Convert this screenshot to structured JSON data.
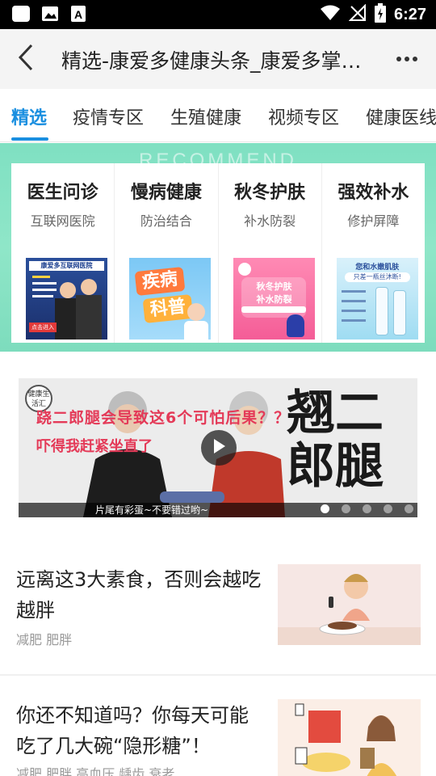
{
  "status_bar": {
    "time": "6:27",
    "left_icons": [
      "app-square-icon",
      "image-icon",
      "font-a-icon"
    ],
    "right_icons": [
      "wifi-icon",
      "no-signal-icon",
      "battery-charging-icon"
    ]
  },
  "app_bar": {
    "back_icon": "chevron-left-icon",
    "title": "精选-康爱多健康头条_康爱多掌…",
    "more_icon": "more-dots-icon"
  },
  "tabs": [
    "精选",
    "疫情专区",
    "生殖健康",
    "视频专区",
    "健康医线"
  ],
  "recommend": {
    "watermark": "RECOMMEND",
    "items": [
      {
        "title": "医生问诊",
        "subtitle": "互联网医院",
        "thumb_text": [
          "康爱多互联网医院",
          "点击进入"
        ]
      },
      {
        "title": "慢病健康",
        "subtitle": "防治结合",
        "thumb_text": [
          "疾病",
          "科普"
        ]
      },
      {
        "title": "秋冬护肤",
        "subtitle": "补水防裂",
        "thumb_text": [
          "秋冬护肤",
          "补水防裂"
        ]
      },
      {
        "title": "强效补水",
        "subtitle": "修护屏障",
        "thumb_text": [
          "您和水嫩肌肤",
          "只差一瓶丝沐断!"
        ]
      }
    ]
  },
  "banner": {
    "headline": "跷二郎腿会导致这6个可怕后果？？",
    "subline": "吓得我赶紧坐直了",
    "big_text": "翘二郎腿",
    "caption": "片尾有彩蛋~不要错过哟~",
    "logo_text": "健康生活汇",
    "slide_count": 5,
    "active_slide": 1
  },
  "articles": [
    {
      "title": "远离这3大素食，否则会越吃越胖",
      "tags": "减肥 肥胖"
    },
    {
      "title": "你还不知道吗？你每天可能吃了几大碗“隐形糖”！",
      "tags": "减肥 肥胖 高血压 龋齿 衰老"
    }
  ],
  "colors": {
    "accent": "#1a8fe0",
    "recommend_bg": "#86e2c4",
    "banner_text": "#e43a58"
  }
}
